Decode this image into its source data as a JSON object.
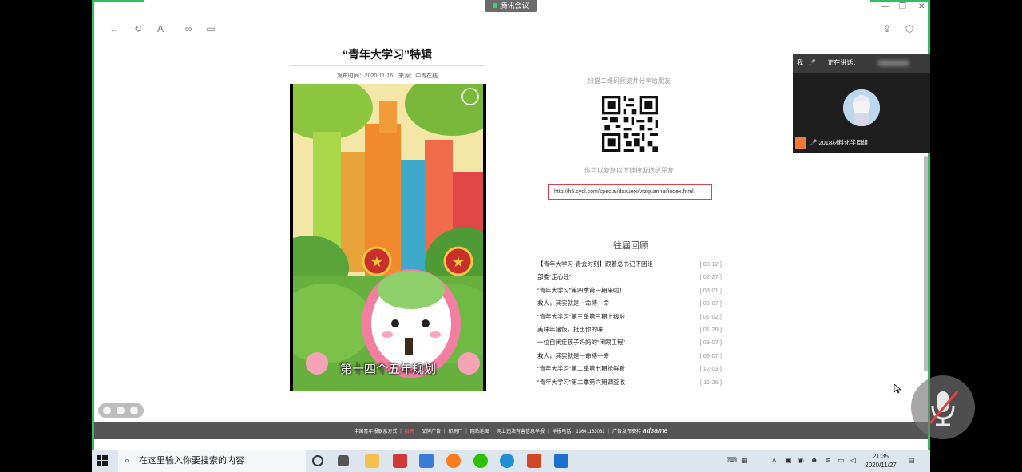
{
  "meeting_tab": "腾讯会议",
  "article": {
    "title": "“青年大学习”特辑",
    "meta": "发布时间：2020-11-16　来源：中青在线",
    "video_caption": "第十四个五年规划"
  },
  "share": {
    "scan_text": "扫描二维码预览并分享给朋友",
    "copy_text": "你可以复制以下链接发送给朋友",
    "url": "http://h5.cyol.com/special/daxuexi/vrzquanhui/index.html"
  },
  "past": {
    "title": "往届回顾",
    "items": [
      {
        "label": "【青年大学习·青会时刻】跟着总书记下团组",
        "date": "[ 03-12 ]"
      },
      {
        "label": "部委“走心经”",
        "date": "[ 02-27 ]"
      },
      {
        "label": "“青年大学习”第四季第一期来啦！",
        "date": "[ 03-01 ]"
      },
      {
        "label": "救人，其实就是一命搏一命",
        "date": "[ 03-07 ]"
      },
      {
        "label": "“青年大学习”第三季第三期上线啦",
        "date": "[ 01-02 ]"
      },
      {
        "label": "美味年猪饭，抵出你的味",
        "date": "[ 01-29 ]"
      },
      {
        "label": "一位自闭症孩子妈妈的“闭眼工程”",
        "date": "[ 03-07 ]"
      },
      {
        "label": "救人，其实就是一命搏一命",
        "date": "[ 03-07 ]"
      },
      {
        "label": "“青年大学习”第二季第七期抢鲜看",
        "date": "[ 12-03 ]"
      },
      {
        "label": "“青年大学习”第二季第六期调查收",
        "date": "[ 11-26 ]"
      }
    ]
  },
  "footer": {
    "left": "中国青年报联系方式 ｜",
    "red": "招聘",
    "right": "｜ 品牌广告 ｜ 印刷厂 ｜ 网站地图 ｜ 网上违法有害信息举报 ｜ 举报电话：13641163081 ｜ 广告发布支持",
    "brand": "adsame"
  },
  "meeting": {
    "me": "我",
    "speaking": "正在讲话：",
    "participant": "2018材料化学周组"
  },
  "taskbar": {
    "search_placeholder": "在这里输入你要搜索的内容",
    "time": "21:35",
    "date": "2020/11/27",
    "apps": [
      "task-view",
      "file-explorer",
      "app-red",
      "store",
      "firefox",
      "wechat",
      "edge",
      "powerpoint",
      "app-blue"
    ]
  },
  "colors": {
    "accent_green": "#2fbf5c",
    "url_border": "#d9434d",
    "footer_bg": "#555555"
  }
}
